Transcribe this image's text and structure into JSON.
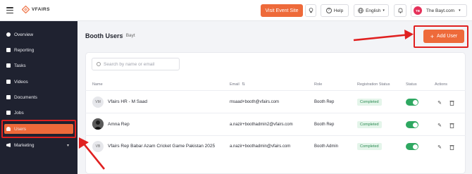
{
  "brand": {
    "name": "VFAIRS"
  },
  "topbar": {
    "visit_label": "Visit Event Site",
    "help_label": "Help",
    "language": "English",
    "user_initials": "TB",
    "user_name": "The Bayt.com"
  },
  "sidebar": {
    "items": [
      {
        "label": "Overview"
      },
      {
        "label": "Reporting"
      },
      {
        "label": "Tasks"
      },
      {
        "label": "Videos"
      },
      {
        "label": "Documents"
      },
      {
        "label": "Jobs"
      },
      {
        "label": "Users"
      },
      {
        "label": "Marketing"
      }
    ]
  },
  "header": {
    "title": "Booth Users",
    "subtitle": "Bayt",
    "add_label": "Add User"
  },
  "search": {
    "placeholder": "Search by name or email"
  },
  "table": {
    "columns": [
      "Name",
      "Email",
      "Role",
      "Registration Status",
      "Status",
      "Actions"
    ],
    "rows": [
      {
        "initials": "VM",
        "name": "Vfairs HR - M Saad",
        "email": "msaad+booth@vfairs.com",
        "role": "Booth Rep",
        "status": "Completed"
      },
      {
        "initials": "",
        "name": "Amna Rep",
        "email": "a.nazir+boothadmin2@vfairs.com",
        "role": "Booth Rep",
        "status": "Completed"
      },
      {
        "initials": "VB",
        "name": "Vfairs Rep Babar Azam Cricket Game Pakistan 2025",
        "email": "a.nazir+boothadmin@vfairs.com",
        "role": "Booth Admin",
        "status": "Completed"
      }
    ]
  },
  "colors": {
    "accent": "#ee6a3a",
    "sidebar_bg": "#1f2230",
    "annotation": "#e02020",
    "toggle_on": "#2ea861"
  }
}
